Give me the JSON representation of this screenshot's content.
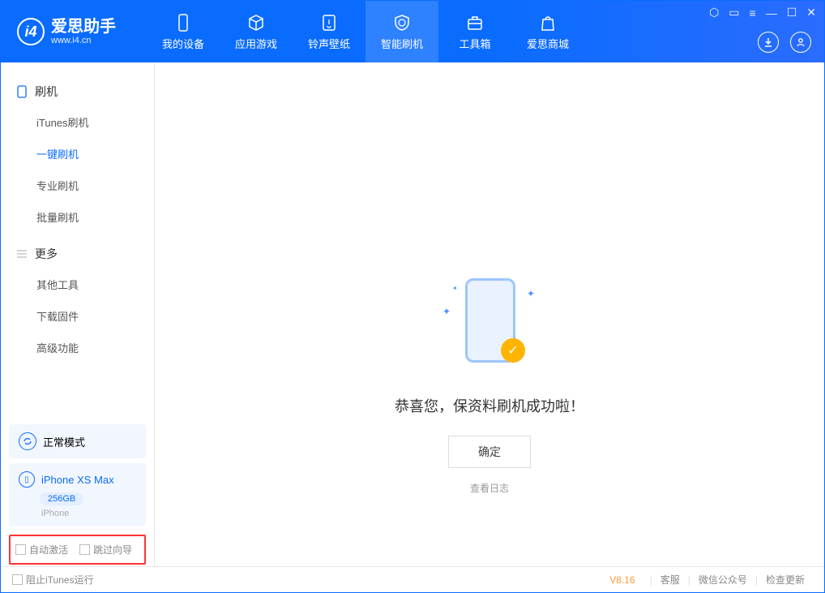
{
  "app": {
    "title": "爱思助手",
    "subtitle": "www.i4.cn"
  },
  "nav": {
    "items": [
      {
        "label": "我的设备"
      },
      {
        "label": "应用游戏"
      },
      {
        "label": "铃声壁纸"
      },
      {
        "label": "智能刷机"
      },
      {
        "label": "工具箱"
      },
      {
        "label": "爱思商城"
      }
    ],
    "activeIndex": 3
  },
  "sidebar": {
    "group1": {
      "title": "刷机",
      "items": [
        "iTunes刷机",
        "一键刷机",
        "专业刷机",
        "批量刷机"
      ],
      "activeIndex": 1
    },
    "group2": {
      "title": "更多",
      "items": [
        "其他工具",
        "下载固件",
        "高级功能"
      ]
    },
    "mode": "正常模式",
    "device": {
      "name": "iPhone XS Max",
      "capacity": "256GB",
      "type": "iPhone"
    },
    "options": {
      "autoActivate": "自动激活",
      "skipGuide": "跳过向导"
    }
  },
  "content": {
    "message": "恭喜您，保资料刷机成功啦！",
    "confirm": "确定",
    "viewLog": "查看日志"
  },
  "statusbar": {
    "blockItunes": "阻止iTunes运行",
    "version": "V8.16",
    "links": [
      "客服",
      "微信公众号",
      "检查更新"
    ]
  }
}
